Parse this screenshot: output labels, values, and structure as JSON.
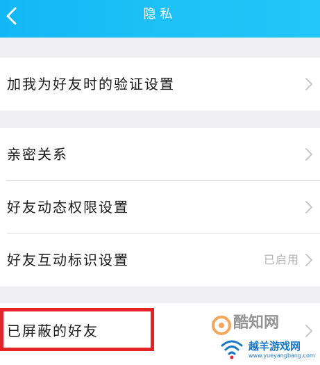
{
  "header": {
    "title": "隐私",
    "back_icon": "chevron-left-icon",
    "background": "#12b7f5"
  },
  "sections": [
    {
      "items": [
        {
          "label": "加我为好友时的验证设置",
          "value": "",
          "icon": "chevron-right-icon"
        }
      ]
    },
    {
      "items": [
        {
          "label": "亲密关系",
          "value": "",
          "icon": "chevron-right-icon"
        },
        {
          "label": "好友动态权限设置",
          "value": "",
          "icon": "chevron-right-icon"
        },
        {
          "label": "好友互动标识设置",
          "value": "已启用",
          "icon": "chevron-right-icon"
        }
      ]
    },
    {
      "items": [
        {
          "label": "已屏蔽的好友",
          "value": "",
          "icon": "chevron-right-icon"
        }
      ]
    }
  ],
  "watermark": {
    "line1": "酷知网",
    "line2": "越羊游戏网",
    "line3": "www.yueyangbang.com"
  },
  "colors": {
    "highlight_border": "#e52429",
    "page_background": "#efeff4",
    "chevron": "#c7c7cc",
    "value_text": "#b2b2b2"
  }
}
